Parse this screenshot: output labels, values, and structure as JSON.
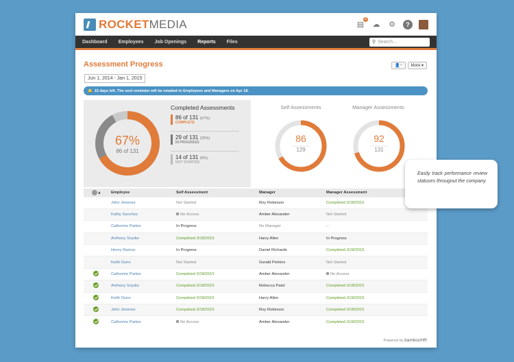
{
  "brand": {
    "prefix": "ROCKET",
    "suffix": "MEDIA",
    "accent": "#e07b39",
    "blue": "#4b93c4"
  },
  "topbar": {
    "notification_count": "2",
    "icons": [
      "inbox-icon",
      "cloud-icon",
      "gear-icon",
      "help-icon",
      "avatar"
    ]
  },
  "nav": {
    "items": [
      "Dashboard",
      "Employees",
      "Job Openings",
      "Reports",
      "Files"
    ],
    "active": "Reports",
    "search_placeholder": "Search..."
  },
  "page": {
    "title": "Assessment Progress",
    "more_label": "More",
    "date_range": "Jun 1, 2014 - Jan 1, 2015",
    "notice": "15 days left. The next reminder will be emailed to Employees and Managers on Apr 18."
  },
  "completed": {
    "title": "Completed Assessments",
    "percent": "67%",
    "fraction": "86 of 131",
    "percent_value": 0.67,
    "items": [
      {
        "value": "86 of 131",
        "pct": "(67%)",
        "label": "COMPLETE",
        "color": "#e07b39"
      },
      {
        "value": "29 of 131",
        "pct": "(25%)",
        "label": "IN PROGRESS",
        "color": "#777777"
      },
      {
        "value": "14 of 131",
        "pct": "(8%)",
        "label": "NOT STARTED",
        "color": "#bbbbbb"
      }
    ]
  },
  "self": {
    "title": "Self Assessments",
    "done": "86",
    "total": "129",
    "ratio": 0.667
  },
  "manager": {
    "title": "Manager Assessments",
    "done": "92",
    "total": "131",
    "ratio": 0.702
  },
  "table": {
    "headers": [
      "Employee",
      "Self Assessment",
      "Manager",
      "Manager Assessment"
    ],
    "rows": [
      {
        "check": false,
        "employee": "John Jimenez",
        "self": "Not Started",
        "self_state": "muted",
        "manager": "Roy Robinson",
        "mgr": "Completed 3/18/2015",
        "mgr_state": "green"
      },
      {
        "check": false,
        "employee": "Kathy Sanchez",
        "self": "No Access",
        "self_state": "lock",
        "manager": "Amber Alexander",
        "mgr": "Not Started",
        "mgr_state": "muted"
      },
      {
        "check": false,
        "employee": "Catherine Parker",
        "self": "In Progress",
        "self_state": "normal",
        "manager": "No Manager",
        "mgr": "--",
        "mgr_state": "muted",
        "manager_state": "muted"
      },
      {
        "check": false,
        "employee": "Anthony Snyder",
        "self": "Completed 3/18/2015",
        "self_state": "green",
        "manager": "Harry Allen",
        "mgr": "In Progress",
        "mgr_state": "normal"
      },
      {
        "check": false,
        "employee": "Henry Ramos",
        "self": "In Progress",
        "self_state": "normal",
        "manager": "Daniel Richards",
        "mgr": "Completed 3/18/2015",
        "mgr_state": "green"
      },
      {
        "check": false,
        "employee": "Keith Dunn",
        "self": "Not Started",
        "self_state": "muted",
        "manager": "Gerald Perkins",
        "mgr": "Not Started",
        "mgr_state": "muted"
      },
      {
        "check": true,
        "employee": "Catherine Parker",
        "self": "Completed 3/18/2015",
        "self_state": "green",
        "manager": "Amber Alexander",
        "mgr": "No Access",
        "mgr_state": "lock"
      },
      {
        "check": true,
        "employee": "Anthony Snyder",
        "self": "Completed 3/18/2015",
        "self_state": "green",
        "manager": "Rebecca Patel",
        "mgr": "Completed 3/18/2015",
        "mgr_state": "green"
      },
      {
        "check": true,
        "employee": "Keith Dunn",
        "self": "Completed 3/18/2015",
        "self_state": "green",
        "manager": "Harry Allen",
        "mgr": "Completed 3/18/2015",
        "mgr_state": "green"
      },
      {
        "check": true,
        "employee": "John Jimenez",
        "self": "Completed 3/18/2015",
        "self_state": "green",
        "manager": "Roy Robinson",
        "mgr": "Completed 3/18/2015",
        "mgr_state": "green"
      },
      {
        "check": true,
        "employee": "Catherine Parker",
        "self": "No Access",
        "self_state": "lock",
        "manager": "Amber Alexander",
        "mgr": "Completed 3/18/2015",
        "mgr_state": "green"
      }
    ]
  },
  "footer": {
    "powered": "Powered by",
    "brand": "bambooHR"
  },
  "callout": "Easily track performance review statuses througout the company."
}
